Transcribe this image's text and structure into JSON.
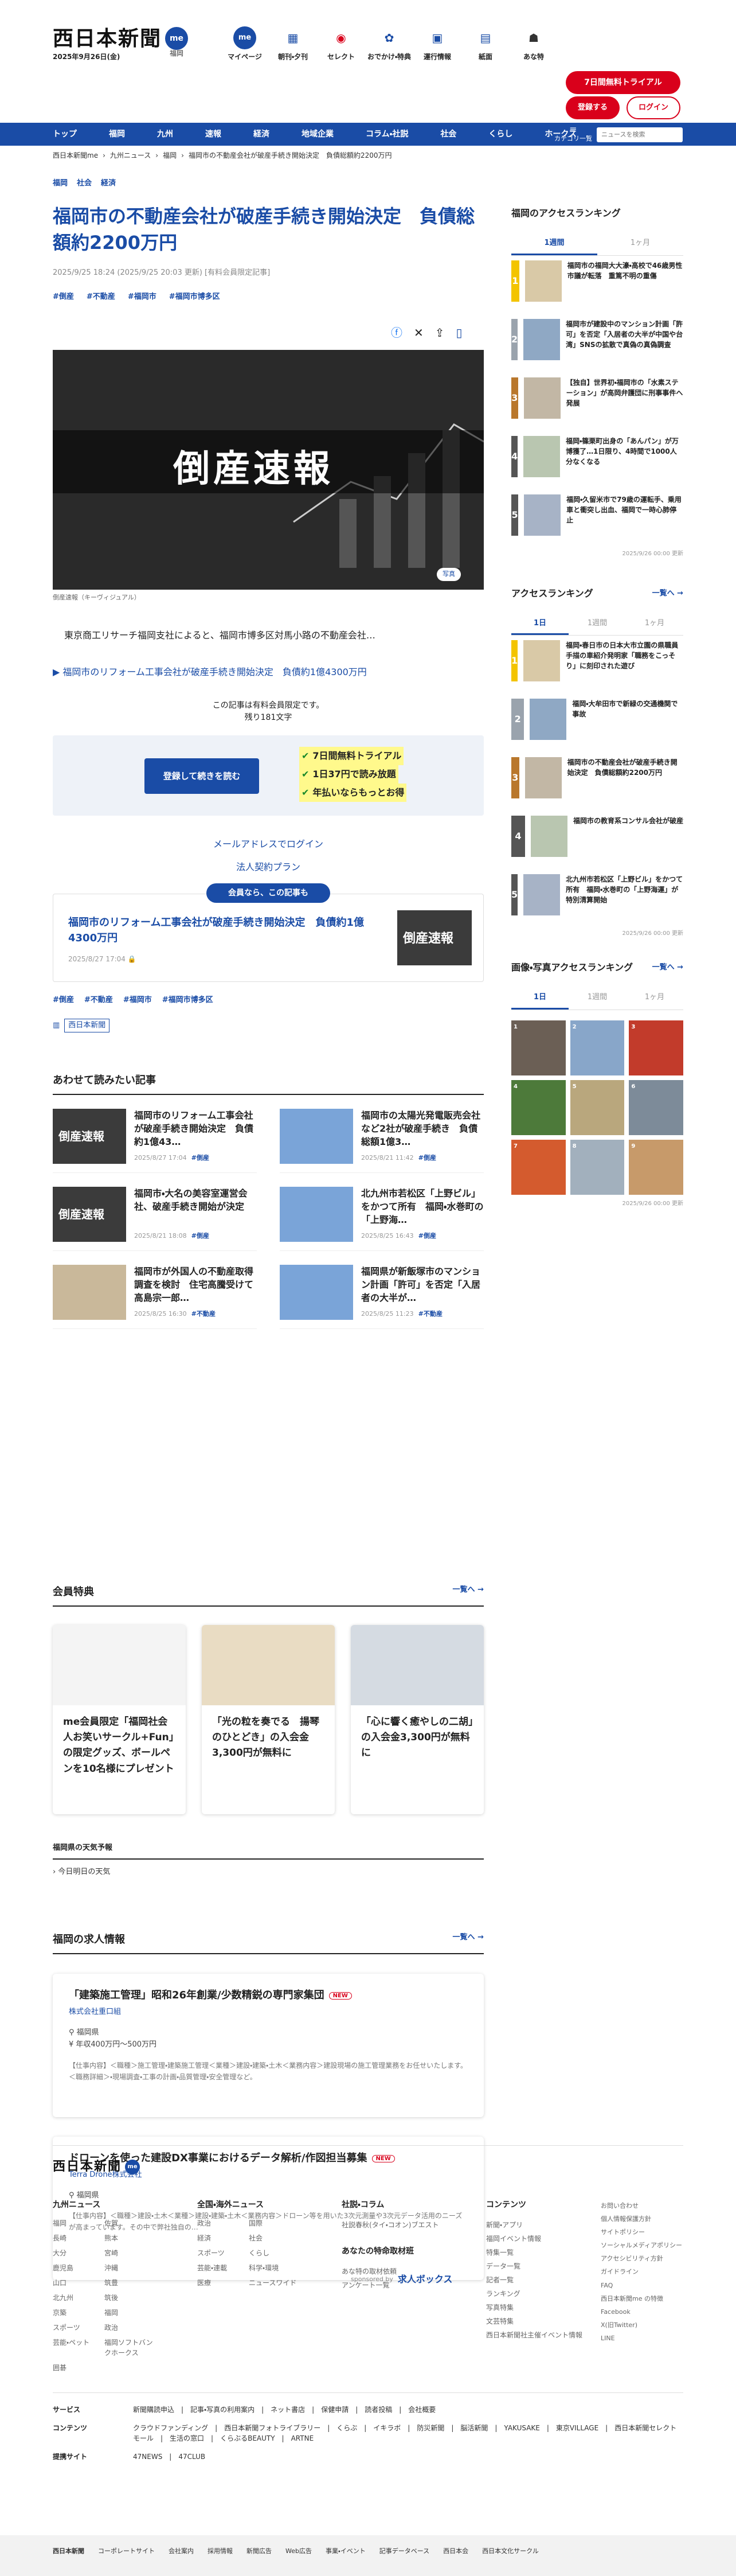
{
  "header": {
    "logo": "西日本新聞",
    "logo_me": "me",
    "date": "2025年9月26日(金)",
    "region": "福岡",
    "icons": [
      {
        "label": "マイページ",
        "icon": "me-icon"
      },
      {
        "label": "朝刊・夕刊",
        "icon": "newspaper-icon"
      },
      {
        "label": "セレクト",
        "icon": "select-icon"
      },
      {
        "label": "おでかけ・特典",
        "icon": "gift-icon"
      },
      {
        "label": "運行情報",
        "icon": "train-icon"
      },
      {
        "label": "紙面",
        "icon": "paper-icon"
      },
      {
        "label": "あな特",
        "icon": "detective-icon"
      }
    ],
    "trial": "7日間無料トライアル",
    "register": "登録する",
    "login": "ログイン"
  },
  "nav": {
    "items": [
      "トップ",
      "福岡",
      "九州",
      "速報",
      "経済",
      "地域企業",
      "コラム・社説",
      "社会",
      "くらし",
      "ホークス"
    ],
    "category": "カテゴリ一覧",
    "search_placeholder": "ニュースを検索"
  },
  "breadcrumb": [
    "西日本新聞me",
    "九州ニュース",
    "福岡",
    "福岡市の不動産会社が破産手続き開始決定　負債総額約2200万円"
  ],
  "article": {
    "top_tags": [
      "福岡",
      "社会",
      "経済"
    ],
    "title": "福岡市の不動産会社が破産手続き開始決定　負債総額約2200万円",
    "meta": "2025/9/25 18:24 (2025/9/25 20:03 更新) [有料会員限定記事]",
    "hash_tags": [
      "#倒産",
      "#不動産",
      "#福岡市",
      "#福岡市博多区"
    ],
    "hero_text": "倒産速報",
    "hero_badge": "写真",
    "caption": "倒産速報（キーヴィジュアル）",
    "lead": "東京商工リサーチ福岡支社によると、福岡市博多区対馬小路の不動産会社…",
    "related_link": "福岡市のリフォーム工事会社が破産手続き開始決定　負債約1億4300万円",
    "paywall_line1": "この記事は有料会員限定です。",
    "paywall_line2": "残り181文字",
    "pay_button": "登録して続きを読む",
    "pay_points": [
      "7日間無料トライアル",
      "1日37円で読み放題",
      "年払いならもっとお得"
    ],
    "mail_login": "メールアドレスでログイン",
    "corp_plan": "法人契約プラン",
    "rec_label": "会員なら、この記事も",
    "rec_title": "福岡市のリフォーム工事会社が破産手続き開始決定　負債約1億4300万円",
    "rec_date": "2025/8/27 17:04",
    "rec_thumb": "倒産速報",
    "bottom_tags": [
      "#倒産",
      "#不動産",
      "#福岡市",
      "#福岡市博多区"
    ],
    "paper_badge": "西日本新聞"
  },
  "also": {
    "title": "あわせて読みたい記事",
    "items": [
      {
        "title": "福岡市のリフォーム工事会社が破産手続き開始決定　負債約1億43…",
        "date": "2025/8/27 17:04",
        "tag": "#倒産",
        "thumb": "倒産速報"
      },
      {
        "title": "福岡市の太陽光発電販売会社など2社が破産手続き　負債総額1億3…",
        "date": "2025/8/21 11:42",
        "tag": "#倒産",
        "thumb": ""
      },
      {
        "title": "福岡市・大名の美容室運営会社、破産手続き開始が決定",
        "date": "2025/8/21 18:08",
        "tag": "#倒産",
        "thumb": "倒産速報"
      },
      {
        "title": "北九州市若松区「上野ビル」をかつて所有　福岡・水巻町の「上野海…",
        "date": "2025/8/25 16:43",
        "tag": "#倒産",
        "thumb": ""
      },
      {
        "title": "福岡市が外国人の不動産取得調査を検討　住宅高騰受けて高島宗一郎…",
        "date": "2025/8/25 16:30",
        "tag": "#不動産",
        "thumb": ""
      },
      {
        "title": "福岡県が新飯塚市のマンション計画「許可」を否定「入居者の大半が…",
        "date": "2025/8/25 11:23",
        "tag": "#不動産",
        "thumb": ""
      }
    ]
  },
  "member": {
    "title": "会員特典",
    "more": "一覧へ",
    "items": [
      {
        "title": "me会員限定「福岡社会人お笑いサークル+Fun」の限定グッズ、ボールペンを10名様にプレゼント"
      },
      {
        "title": "「光の粒を奏でる　揚琴のひとどき」の入会金3,300円が無料に"
      },
      {
        "title": "「心に響く癒やしの二胡」の入会金3,300円が無料に"
      }
    ]
  },
  "weather": {
    "title": "福岡県の天気予報",
    "link": "今日明日の天気"
  },
  "jobs": {
    "title": "福岡の求人情報",
    "more": "一覧へ",
    "items": [
      {
        "title": "「建築施工管理」昭和26年創業/少数精鋭の専門家集団",
        "new": "NEW",
        "company": "株式会社重口組",
        "location": "福岡県",
        "salary": "年収400万円〜500万円",
        "desc": "【仕事内容】＜職種＞施工管理・建築施工管理＜業種＞建設・建築・土木＜業務内容＞建設現場の施工管理業務をお任せいたします。＜職務詳細＞・現場調査・工事の計画・品質管理・安全管理など。"
      },
      {
        "title": "ドローンを使った建設DX事業におけるデータ解析/作図担当募集",
        "new": "NEW",
        "company": "Terra Drone株式会社",
        "location": "福岡県",
        "salary": "",
        "desc": "【仕事内容】＜職種＞建設・土木＜業種＞建設・建築・土木＜業務内容＞ドローン等を用いた3次元測量や3次元データ活用のニーズが高まっています。その中で弊社独自の…"
      }
    ],
    "sponsor": "sponsored by",
    "sponsor_brand": "求人ボックス"
  },
  "side": {
    "access_title": "福岡のアクセスランキング",
    "tabs1": [
      "1週間",
      "1ヶ月"
    ],
    "ranking1": [
      "福岡市の福岡大大濠・高校で46歳男性市議が転落　重篤不明の重傷",
      "福岡市が建設中のマンション計画「許可」を否定「入居者の大半が中国や台湾」SNSの拡散で真偽の真偽調査",
      "【独自】世界初・福岡市の「水素ステーション」が高岡弁護団に刑事事件へ発展",
      "福岡・篠栗町出身の「あんパン」が万博獲了…1日限り、4時間で1000人分なくなる",
      "福岡・久留米市で79歳の運転手、乗用車と衝突し出血、福岡で一時心肺停止"
    ],
    "upd1": "2025/9/26 00:00 更新",
    "access2_title": "アクセスランキング",
    "tabs2": [
      "1日",
      "1週間",
      "1ヶ月"
    ],
    "more": "一覧へ",
    "ranking2": [
      "福岡・春日市の日本大市立園の県職員手描の車紹介発明家「職務をこっそり」に刻印された遊び",
      "福岡・大牟田市で新緑の交通機関で事故",
      "福岡市の不動産会社が破産手続き開始決定　負債総額約2200万円",
      "福岡市の教育系コンサル会社が破産",
      "北九州市若松区「上野ビル」をかつて所有　福岡・水巻町の「上野海運」が特別清算開始"
    ],
    "upd2": "2025/9/26 00:00 更新",
    "photo_title": "画像・写真アクセスランキング",
    "tabs3": [
      "1日",
      "1週間",
      "1ヶ月"
    ],
    "photos": [
      "1",
      "2",
      "3",
      "4",
      "5",
      "6",
      "7",
      "8",
      "9"
    ],
    "upd3": "2025/9/26 00:00 更新"
  },
  "footer": {
    "logo": "西日本新聞",
    "logo_me": "me",
    "cols": [
      {
        "title": "九州ニュース",
        "items": [
          "福岡",
          "佐賀",
          "長崎",
          "熊本",
          "大分",
          "宮崎",
          "鹿児島",
          "沖縄",
          "山口",
          "筑豊",
          "北九州",
          "筑後",
          "京築",
          "福岡",
          "スポーツ",
          "政治",
          "芸能・ペット",
          "福岡ソフトバンクホークス",
          "囲碁"
        ]
      },
      {
        "title": "全国・海外ニュース",
        "items": [
          "政治",
          "国際",
          "経済",
          "社会",
          "スポーツ",
          "くらし",
          "芸能・連載",
          "科学・環境",
          "医療",
          "ニュースワイド"
        ]
      },
      {
        "title": "社説・コラム",
        "items": [
          "社説",
          "春秋(タイ・コオン)",
          "ブエスト"
        ]
      }
    ],
    "subcol_title": "あなたの特命取材班",
    "subcol_items": [
      "あな特の取材依頼",
      "アンケート一覧"
    ],
    "content_title": "コンテンツ",
    "content_items": [
      "新聞・アプリ",
      "福岡イベント情報",
      "特集一覧",
      "データ一覧",
      "記者一覧",
      "ランキング",
      "写真特集",
      "文芸特集",
      "西日本新聞社主催イベント情報"
    ],
    "right_items": [
      "お問い合わせ",
      "個人情報保護方針",
      "サイトポリシー",
      "ソーシャルメディアポリシー",
      "アクセシビリティ方針",
      "ガイドライン",
      "FAQ",
      "西日本新聞me の特徴",
      "Facebook",
      "X(旧Twitter)",
      "LINE"
    ],
    "rows": [
      {
        "label": "サービス",
        "text": "新聞購読申込　|　記事・写真の利用案内　|　ネット書店　|　保健申請　|　読者投稿　|　会社概要"
      },
      {
        "label": "コンテンツ",
        "text": "クラウドファンディング　|　西日本新聞フォトライブラリー　|　くらぶ　|　イキラボ　|　防災新聞　|　脳活新聞　|　YAKUSAKE　|　東京VILLAGE　|　西日本新聞セレクトモール　|　生活の窓口　|　くらぶるBEAUTY　|　ARTNE"
      },
      {
        "label": "提携サイト",
        "text": "47NEWS　|　47CLUB"
      }
    ],
    "bottom": [
      "西日本新聞",
      "コーポレートサイト",
      "会社案内",
      "採用情報",
      "新聞広告",
      "Web広告",
      "事業・イベント",
      "記事データベース",
      "西日本会",
      "西日本文化サークル"
    ]
  }
}
